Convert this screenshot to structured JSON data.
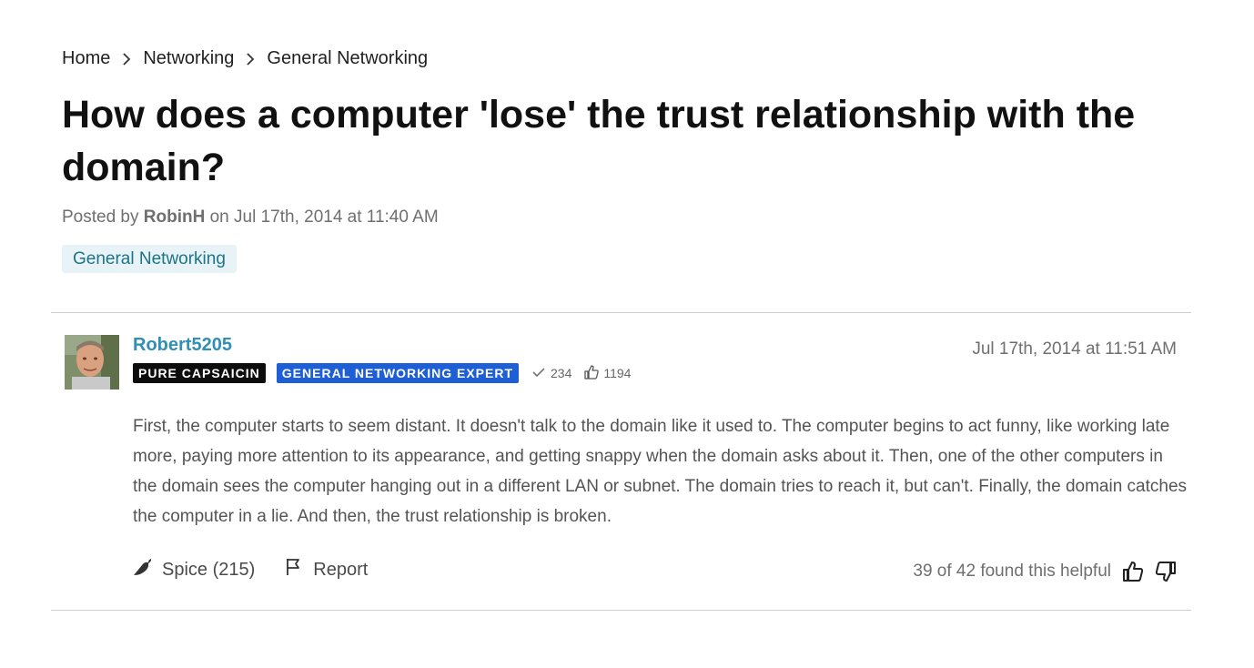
{
  "breadcrumb": {
    "items": [
      "Home",
      "Networking",
      "General Networking"
    ]
  },
  "topic": {
    "title": "How does a computer 'lose' the trust relationship with the domain?",
    "posted_prefix": "Posted by",
    "author": "RobinH",
    "posted_on": "on Jul 17th, 2014 at 11:40 AM",
    "tag": "General Networking"
  },
  "reply": {
    "username": "Robert5205",
    "badges": [
      "PURE CAPSAICIN",
      "GENERAL NETWORKING EXPERT"
    ],
    "best_answers": "234",
    "helpful_votes": "1194",
    "date": "Jul 17th, 2014 at 11:51 AM",
    "body": "First, the computer starts to seem distant. It doesn't talk to the domain like it used to. The computer begins to act funny, like working late more, paying more attention to its appearance, and getting snappy when the domain asks about it. Then, one of the other computers in the domain sees the computer hanging out in a different LAN or subnet. The domain tries to reach it, but can't. Finally, the domain catches the computer in a lie. And then, the trust relationship is broken.",
    "actions": {
      "spice_label": "Spice (215)",
      "report_label": "Report"
    },
    "helpful_text": "39 of 42 found this helpful"
  },
  "colors": {
    "link": "#2f8fb5",
    "tag_bg": "#e7f3f6",
    "tag_text": "#1e7486",
    "badge_black": "#0d0d0d",
    "badge_blue": "#1f5fd6"
  },
  "icons": [
    "chevron-right-icon",
    "checkmark-icon",
    "thumbs-up-icon",
    "pepper-icon",
    "flag-icon",
    "thumbs-down-icon"
  ]
}
